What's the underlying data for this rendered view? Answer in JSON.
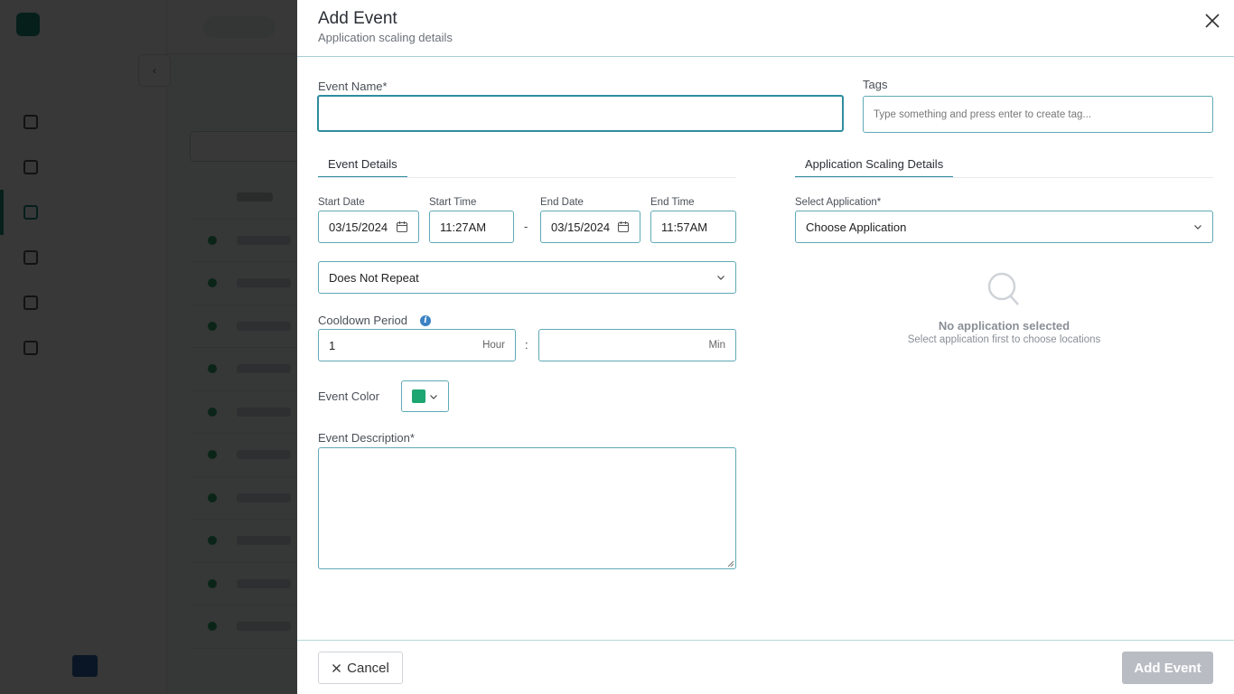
{
  "background": {
    "sidebar_items": 6,
    "table_rows": 10
  },
  "drawer": {
    "title": "Add Event",
    "subtitle": "Application scaling details",
    "close_icon": "close-icon"
  },
  "form": {
    "event_name": {
      "label": "Event Name*",
      "value": ""
    },
    "tags": {
      "label": "Tags",
      "placeholder": "Type something and press enter to create tag..."
    },
    "tabs": {
      "event_details": "Event Details",
      "app_scaling": "Application Scaling Details"
    },
    "start_date": {
      "label": "Start Date",
      "value": "03/15/2024"
    },
    "start_time": {
      "label": "Start Time",
      "value": "11:27AM"
    },
    "separator": "-",
    "end_date": {
      "label": "End Date",
      "value": "03/15/2024"
    },
    "end_time": {
      "label": "End Time",
      "value": "11:57AM"
    },
    "repeat": {
      "value": "Does Not Repeat"
    },
    "cooldown": {
      "label": "Cooldown Period",
      "hours_value": "1",
      "hours_suffix": "Hour",
      "colon": ":",
      "minutes_value": "",
      "minutes_suffix": "Min"
    },
    "event_color": {
      "label": "Event Color",
      "color": "#1ea672"
    },
    "description": {
      "label": "Event Description*",
      "value": ""
    },
    "select_application": {
      "label": "Select Application*",
      "value": "Choose Application"
    },
    "empty_state": {
      "title": "No application selected",
      "subtitle": "Select application first to choose locations"
    }
  },
  "footer": {
    "cancel_label": "Cancel",
    "add_label": "Add Event"
  },
  "colors": {
    "accent": "#2f8c9e",
    "overlay": "rgba(0,0,0,0.78)",
    "disabled_button": "#b9bdc3"
  }
}
